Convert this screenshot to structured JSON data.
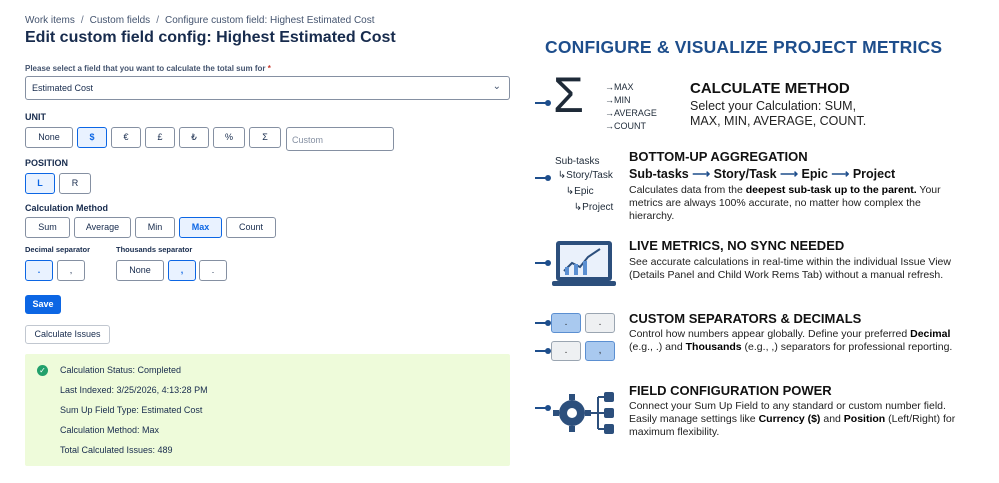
{
  "breadcrumb": {
    "items": [
      "Work items",
      "Custom fields",
      "Configure custom field: Highest Estimated Cost"
    ],
    "separator": "/"
  },
  "page_title": "Edit custom field config: Highest Estimated Cost",
  "field_select": {
    "label": "Please select a field that you want to calculate the total sum for",
    "required_mark": "*",
    "value": "Estimated Cost"
  },
  "unit": {
    "label": "UNIT",
    "options": [
      "None",
      "$",
      "€",
      "£",
      "₺",
      "%",
      "Σ"
    ],
    "selected": "$",
    "custom_placeholder": "Custom"
  },
  "position": {
    "label": "POSITION",
    "options": [
      "L",
      "R"
    ],
    "selected": "L"
  },
  "calculation_method": {
    "label": "Calculation Method",
    "options": [
      "Sum",
      "Average",
      "Min",
      "Max",
      "Count"
    ],
    "selected": "Max"
  },
  "decimal_separator": {
    "label": "Decimal separator",
    "options": [
      ".",
      ","
    ],
    "selected": "."
  },
  "thousands_separator": {
    "label": "Thousands separator",
    "options": [
      "None",
      ",",
      "."
    ],
    "selected": ","
  },
  "save_label": "Save",
  "calculate_label": "Calculate Issues",
  "status": {
    "lines": [
      "Calculation Status: Completed",
      "Last Indexed: 3/25/2026, 4:13:28 PM",
      "Sum Up Field Type: Estimated Cost",
      "Calculation Method: Max",
      "Total Calculated Issues: 489"
    ]
  },
  "promo": {
    "title": "CONFIGURE & VISUALIZE PROJECT METRICS",
    "calc": {
      "items": [
        "MAX",
        "MIN",
        "AVERAGE",
        "COUNT"
      ],
      "title": "CALCULATE METHOD",
      "desc": "Select your Calculation: SUM, MAX, MIN, AVERAGE, COUNT."
    },
    "bottom_up": {
      "tree": [
        "Sub-tasks",
        "Story/Task",
        "Epic",
        "Project"
      ],
      "title": "BOTTOM-UP AGGREGATION",
      "chain": [
        "Sub-tasks",
        "Story/Task",
        "Epic",
        "Project"
      ],
      "desc_1": "Calculates data from the ",
      "desc_bold": "deepest sub-task up to the parent.",
      "desc_2": " Your metrics are always 100% accurate, no matter how complex the hierarchy."
    },
    "live": {
      "title": "LIVE METRICS, NO SYNC NEEDED",
      "desc": "See accurate calculations in real-time within the individual Issue View (Details Panel and Child Work Rems Tab) without a manual refresh."
    },
    "separators": {
      "title": "CUSTOM SEPARATORS & DECIMALS",
      "desc_1": "Control how numbers appear globally. Define your preferred ",
      "decimal_bold": "Decimal",
      "desc_2": " (e.g., .) and ",
      "thousands_bold": "Thousands",
      "desc_3": " (e.g., ,) separators for professional reporting.",
      "boxes": [
        ".",
        ".",
        ".",
        ","
      ]
    },
    "field_config": {
      "title": "FIELD CONFIGURATION POWER",
      "desc_1": "Connect your Sum Up Field to any standard or custom number field. Easily manage settings like ",
      "currency_bold": "Currency ($)",
      "desc_2": " and ",
      "position_bold": "Position",
      "desc_3": " (Left/Right) for maximum flexibility."
    },
    "accent_color": "#1e4e8c"
  }
}
